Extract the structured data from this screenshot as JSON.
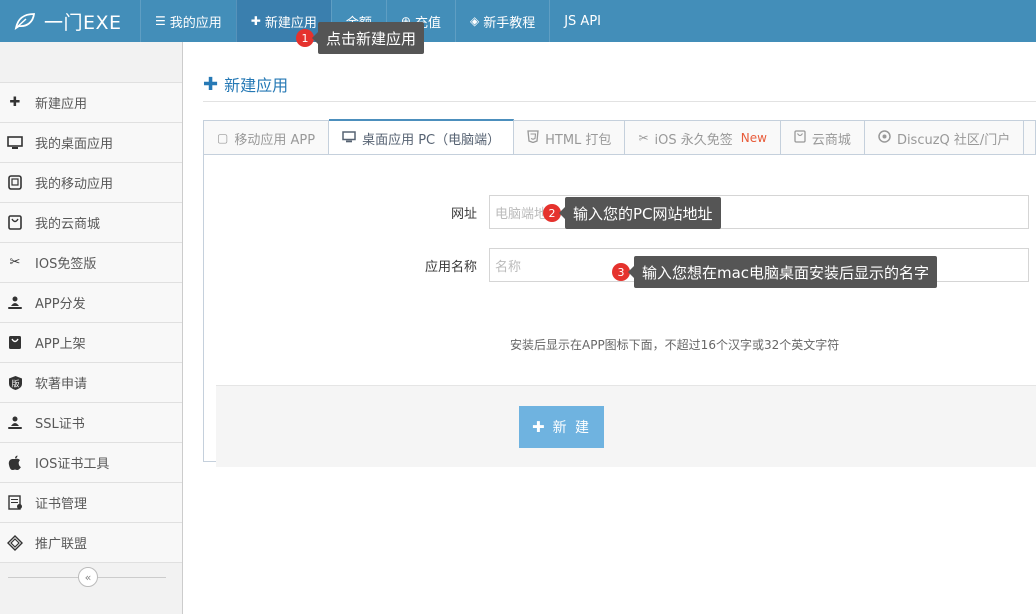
{
  "brand": {
    "name": "一门EXE"
  },
  "nav": [
    {
      "label": "我的应用",
      "icon": "list-icon"
    },
    {
      "label": "新建应用",
      "icon": "plus-icon"
    },
    {
      "label": "余额",
      "icon": ""
    },
    {
      "label": "充值",
      "icon": "coin-icon"
    },
    {
      "label": "新手教程",
      "icon": "diamond-icon"
    },
    {
      "label": "JS API",
      "icon": ""
    }
  ],
  "sidebar": {
    "items": [
      {
        "label": "新建应用",
        "icon": "plus-icon"
      },
      {
        "label": "我的桌面应用",
        "icon": "desktop-icon"
      },
      {
        "label": "我的移动应用",
        "icon": "tablet-icon"
      },
      {
        "label": "我的云商城",
        "icon": "shopping-bag-icon"
      },
      {
        "label": "IOS免签版",
        "icon": "scissors-icon"
      },
      {
        "label": "APP分发",
        "icon": "user-cloud-icon"
      },
      {
        "label": "APP上架",
        "icon": "store-icon"
      },
      {
        "label": "软著申请",
        "icon": "copyright-badge-icon"
      },
      {
        "label": "SSL证书",
        "icon": "user-cloud-icon"
      },
      {
        "label": "IOS证书工具",
        "icon": "apple-icon"
      },
      {
        "label": "证书管理",
        "icon": "document-icon"
      },
      {
        "label": "推广联盟",
        "icon": "diamond-icon"
      }
    ]
  },
  "main": {
    "title": "新建应用",
    "tabs": [
      {
        "label": "移动应用 APP",
        "icon": "tablet-icon"
      },
      {
        "label": "桌面应用 PC（电脑端）",
        "icon": "desktop-icon"
      },
      {
        "label": "HTML 打包",
        "icon": "html5-icon"
      },
      {
        "label": "iOS 永久免签",
        "icon": "scissors-icon",
        "badge": "New"
      },
      {
        "label": "云商城",
        "icon": "shopping-bag-icon"
      },
      {
        "label": "DiscuzQ 社区/门户",
        "icon": "discuz-icon"
      }
    ],
    "form": {
      "url_label": "网址",
      "url_placeholder": "电脑端地址",
      "name_label": "应用名称",
      "name_placeholder": "名称",
      "name_help": "安装后显示在APP图标下面，不超过16个汉字或32个英文字符",
      "submit_label": "新 建"
    }
  },
  "hints": [
    {
      "num": "1",
      "text": "点击新建应用"
    },
    {
      "num": "2",
      "text": "输入您的PC网站地址"
    },
    {
      "num": "3",
      "text": "输入您想在mac电脑桌面安装后显示的名字"
    }
  ],
  "colors": {
    "navbar": "#438eb9",
    "accent": "#2679b5",
    "button": "#6fb3e0",
    "hint_badge": "#e5322d",
    "tooltip": "#555555",
    "new_badge": "#e85b3a"
  }
}
